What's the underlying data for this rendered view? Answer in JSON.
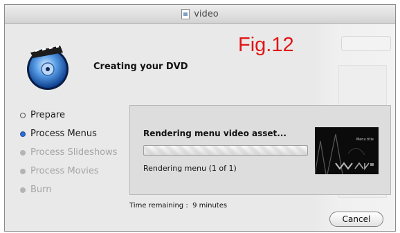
{
  "window": {
    "title": "video",
    "title_icon": "document-icon"
  },
  "overlay": {
    "figure_label": "Fig.12",
    "figure_label_color": "#e01515"
  },
  "header": {
    "title": "Creating your DVD",
    "icon": "idvd-disc-icon"
  },
  "steps": [
    {
      "label": "Prepare",
      "state": "done"
    },
    {
      "label": "Process Menus",
      "state": "active"
    },
    {
      "label": "Process Slideshows",
      "state": "pending"
    },
    {
      "label": "Process Movies",
      "state": "pending"
    },
    {
      "label": "Burn",
      "state": "pending"
    }
  ],
  "progress_panel": {
    "status": "Rendering menu video asset...",
    "detail": "Rendering menu (1 of 1)",
    "progress_style": "indeterminate",
    "preview_title": "Menu title"
  },
  "footer": {
    "time_label": "Time remaining :",
    "time_value": "9 minutes",
    "cancel_label": "Cancel"
  },
  "colors": {
    "active_step": "#2a6fd6",
    "pending_step": "#a5a5a5",
    "background": "#e9e9e9"
  }
}
